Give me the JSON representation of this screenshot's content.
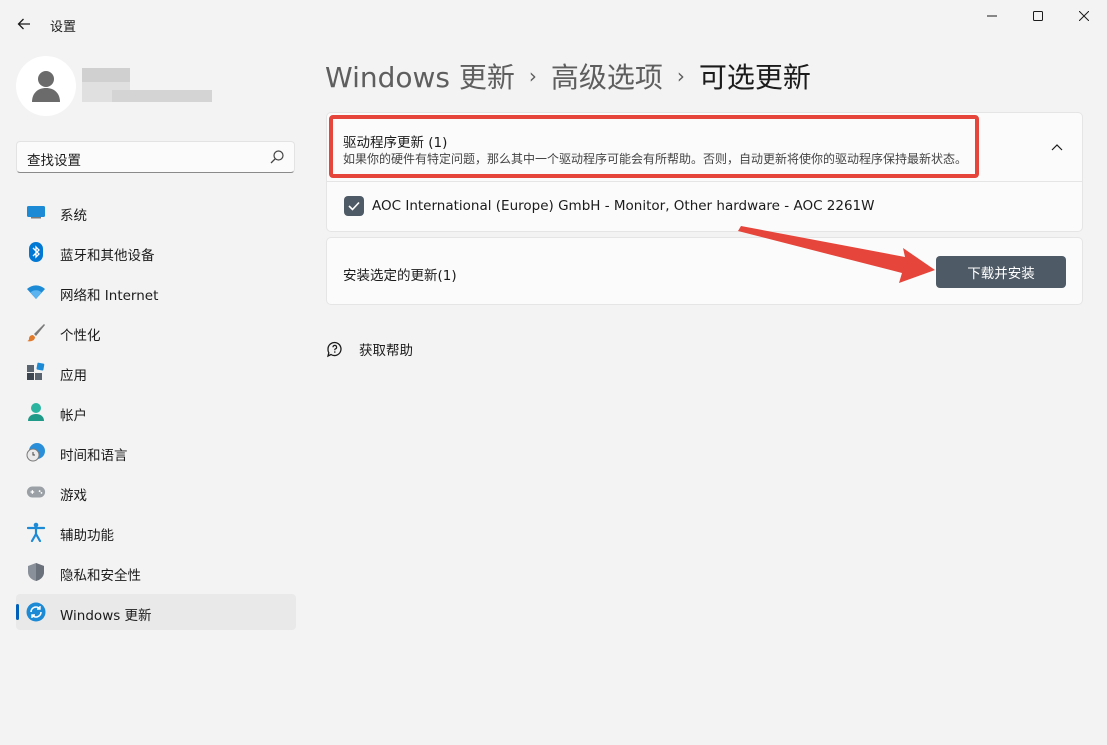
{
  "app": {
    "title": "设置"
  },
  "search": {
    "placeholder": "查找设置"
  },
  "sidebar": {
    "items": [
      {
        "label": "系统",
        "icon": "system-icon"
      },
      {
        "label": "蓝牙和其他设备",
        "icon": "bluetooth-icon"
      },
      {
        "label": "网络和 Internet",
        "icon": "wifi-icon"
      },
      {
        "label": "个性化",
        "icon": "brush-icon"
      },
      {
        "label": "应用",
        "icon": "apps-icon"
      },
      {
        "label": "帐户",
        "icon": "account-icon"
      },
      {
        "label": "时间和语言",
        "icon": "time-language-icon"
      },
      {
        "label": "游戏",
        "icon": "gamepad-icon"
      },
      {
        "label": "辅助功能",
        "icon": "accessibility-icon"
      },
      {
        "label": "隐私和安全性",
        "icon": "shield-icon"
      },
      {
        "label": "Windows 更新",
        "icon": "update-icon",
        "active": true
      }
    ]
  },
  "breadcrumb": {
    "items": [
      "Windows 更新",
      "高级选项"
    ],
    "current": "可选更新",
    "separator": "›"
  },
  "driver_section": {
    "title": "驱动程序更新 (1)",
    "description": "如果你的硬件有特定问题，那么其中一个驱动程序可能会有所帮助。否则，自动更新将使你的驱动程序保持最新状态。",
    "expanded": true
  },
  "driver_item": {
    "label": "AOC International (Europe) GmbH - Monitor, Other hardware - AOC 2261W",
    "checked": true
  },
  "install": {
    "label": "安装选定的更新(1)",
    "button": "下载并安装"
  },
  "help": {
    "label": "获取帮助"
  },
  "colors": {
    "accent": "#005fb8",
    "button": "#4e5a66",
    "annotation": "#e5453a"
  }
}
